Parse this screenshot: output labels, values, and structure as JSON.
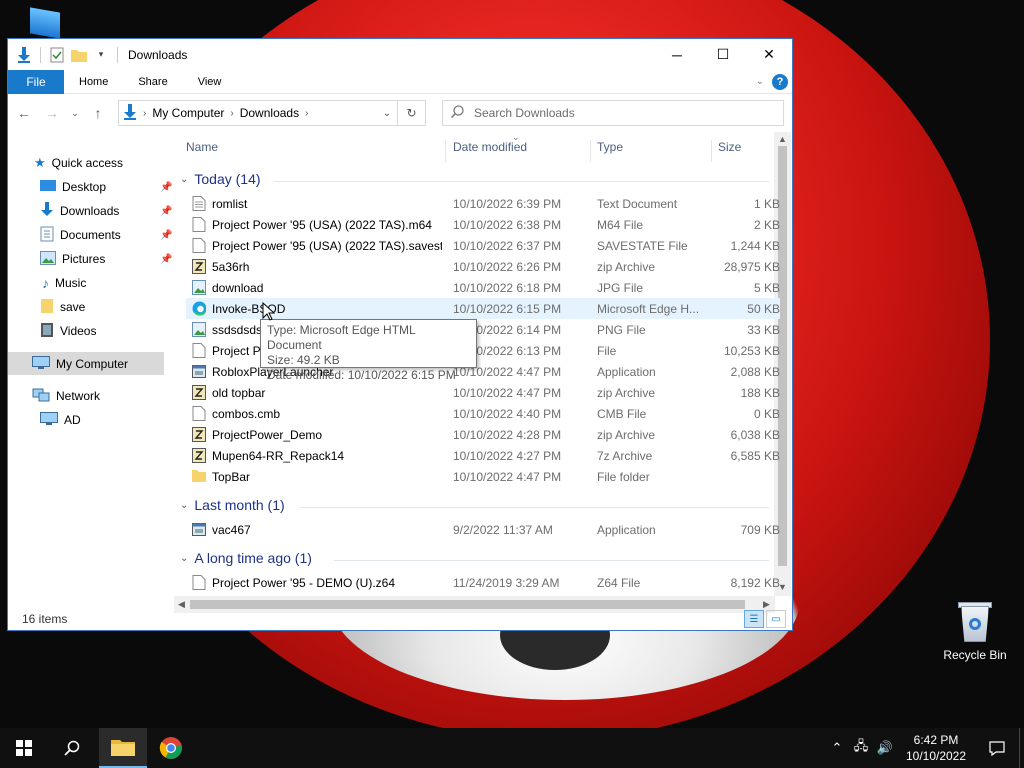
{
  "window": {
    "title": "Downloads",
    "ribbon_tabs": {
      "file": "File",
      "home": "Home",
      "share": "Share",
      "view": "View"
    },
    "help": "?"
  },
  "address": {
    "root": "My Computer",
    "current": "Downloads"
  },
  "search": {
    "placeholder": "Search Downloads"
  },
  "nav": {
    "quick_access": "Quick access",
    "desktop": "Desktop",
    "downloads": "Downloads",
    "documents": "Documents",
    "pictures": "Pictures",
    "music": "Music",
    "save": "save",
    "videos": "Videos",
    "my_computer": "My Computer",
    "network": "Network",
    "ad": "AD"
  },
  "columns": {
    "name": "Name",
    "date": "Date modified",
    "type": "Type",
    "size": "Size"
  },
  "groups": {
    "today": "Today (14)",
    "last_month": "Last month (1)",
    "long_ago": "A long time ago (1)"
  },
  "files": [
    {
      "name": "romlist",
      "date": "10/10/2022 6:39 PM",
      "type": "Text Document",
      "size": "1 KB",
      "icon": "text-file"
    },
    {
      "name": "Project Power '95 (USA) (2022 TAS).m64",
      "date": "10/10/2022 6:38 PM",
      "type": "M64 File",
      "size": "2 KB",
      "icon": "blank-file"
    },
    {
      "name": "Project Power '95 (USA) (2022 TAS).savest...",
      "date": "10/10/2022 6:37 PM",
      "type": "SAVESTATE File",
      "size": "1,244 KB",
      "icon": "blank-file"
    },
    {
      "name": "5a36rh",
      "date": "10/10/2022 6:26 PM",
      "type": "zip Archive",
      "size": "28,975 KB",
      "icon": "archive"
    },
    {
      "name": "download",
      "date": "10/10/2022 6:18 PM",
      "type": "JPG File",
      "size": "5 KB",
      "icon": "image-file"
    },
    {
      "name": "Invoke-BSOD",
      "date": "10/10/2022 6:15 PM",
      "type": "Microsoft Edge H...",
      "size": "50 KB",
      "icon": "edge"
    },
    {
      "name": "ssdsdsdsds",
      "date": "10/10/2022 6:14 PM",
      "type": "PNG File",
      "size": "33 KB",
      "icon": "image-file"
    },
    {
      "name": "Project Power '95",
      "date": "10/10/2022 6:13 PM",
      "type": "File",
      "size": "10,253 KB",
      "icon": "blank-file"
    },
    {
      "name": "RobloxPlayerLauncher",
      "date": "10/10/2022 4:47 PM",
      "type": "Application",
      "size": "2,088 KB",
      "icon": "app"
    },
    {
      "name": "old topbar",
      "date": "10/10/2022 4:47 PM",
      "type": "zip Archive",
      "size": "188 KB",
      "icon": "archive"
    },
    {
      "name": "combos.cmb",
      "date": "10/10/2022 4:40 PM",
      "type": "CMB File",
      "size": "0 KB",
      "icon": "blank-file"
    },
    {
      "name": "ProjectPower_Demo",
      "date": "10/10/2022 4:28 PM",
      "type": "zip Archive",
      "size": "6,038 KB",
      "icon": "archive"
    },
    {
      "name": "Mupen64-RR_Repack14",
      "date": "10/10/2022 4:27 PM",
      "type": "7z Archive",
      "size": "6,585 KB",
      "icon": "archive"
    },
    {
      "name": "TopBar",
      "date": "10/10/2022 4:47 PM",
      "type": "File folder",
      "size": "",
      "icon": "folder"
    }
  ],
  "files_last_month": [
    {
      "name": "vac467",
      "date": "9/2/2022 11:37 AM",
      "type": "Application",
      "size": "709 KB",
      "icon": "app"
    }
  ],
  "files_long_ago": [
    {
      "name": "Project Power '95 - DEMO (U).z64",
      "date": "11/24/2019 3:29 AM",
      "type": "Z64 File",
      "size": "8,192 KB",
      "icon": "blank-file"
    }
  ],
  "tooltip": {
    "type": "Type: Microsoft Edge HTML Document",
    "size": "Size: 49.2 KB",
    "date": "Date modified: 10/10/2022 6:15 PM"
  },
  "status": {
    "items": "16 items"
  },
  "desktop": {
    "recycle_bin": "Recycle Bin"
  },
  "clock": {
    "time": "6:42 PM",
    "date": "10/10/2022"
  },
  "colors": {
    "accent": "#1979ca",
    "group_header": "#1e3287",
    "hover_row": "#e5f3ff"
  }
}
